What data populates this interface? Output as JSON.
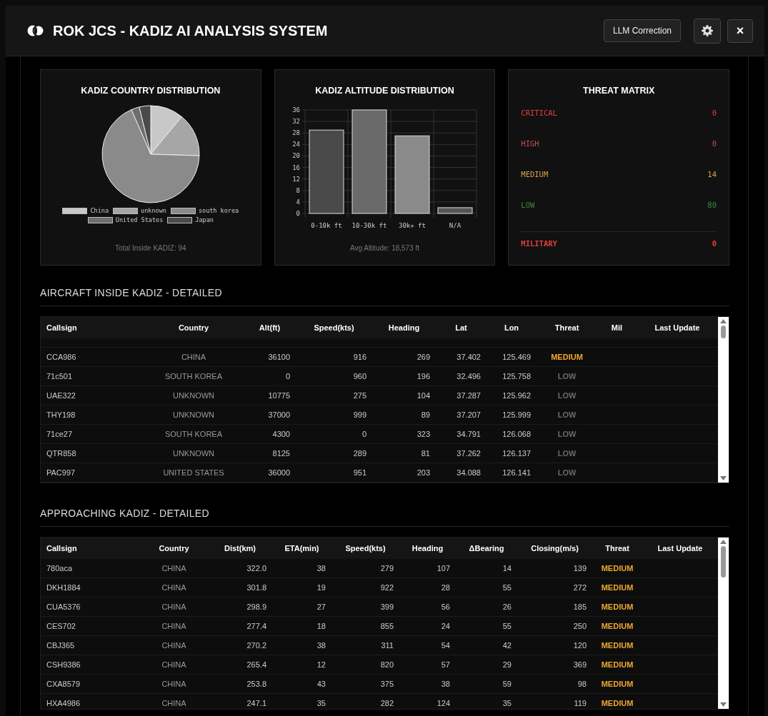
{
  "window": {
    "title": "ROK JCS - KADIZ AI ANALYSIS SYSTEM",
    "buttons": {
      "llm": "LLM Correction",
      "close": "×"
    }
  },
  "country_panel": {
    "title": "KADIZ COUNTRY DISTRIBUTION",
    "legend": [
      {
        "label": "China",
        "color": "#c8c8c8"
      },
      {
        "label": "unknown",
        "color": "#a6a6a6"
      },
      {
        "label": "south korea",
        "color": "#8a8a8a"
      },
      {
        "label": "United States",
        "color": "#6e6e6e"
      },
      {
        "label": "Japan",
        "color": "#4a4a4a"
      }
    ],
    "footer": "Total Inside KADIZ: 94"
  },
  "altitude_panel": {
    "title": "KADIZ ALTITUDE DISTRIBUTION",
    "chart_data": {
      "type": "bar",
      "categories": [
        "0-10k ft",
        "10-30k ft",
        "30k+ ft",
        "N/A"
      ],
      "values": [
        29,
        36,
        27,
        2
      ],
      "grid": true,
      "ylim": [
        0,
        36
      ],
      "yticks": [
        0,
        4,
        8,
        12,
        16,
        20,
        24,
        28,
        32,
        36
      ]
    },
    "footer": "Avg Altitude: 18,573 ft"
  },
  "threat_matrix": {
    "title": "THREAT MATRIX",
    "levels": [
      {
        "label": "CRITICAL",
        "value": "0",
        "color": "#e0403c"
      },
      {
        "label": "HIGH",
        "value": "0",
        "color": "#c0504c"
      },
      {
        "label": "MEDIUM",
        "value": "14",
        "color": "#d6a44a"
      },
      {
        "label": "LOW",
        "value": "80",
        "color": "#3f8a3f"
      }
    ],
    "military": {
      "label": "MILITARY",
      "value": "0"
    }
  },
  "inside_table": {
    "title": "AIRCRAFT INSIDE KADIZ - DETAILED",
    "columns": [
      "Callsign",
      "Country",
      "Alt(ft)",
      "Speed(kts)",
      "Heading",
      "Lat",
      "Lon",
      "Threat",
      "Mil",
      "Last Update"
    ],
    "rows": [
      {
        "cells": [
          "CCA986",
          "CHINA",
          "36100",
          "916",
          "269",
          "37.402",
          "125.469"
        ],
        "threat": {
          "text": "MEDIUM",
          "color": "#f0a830"
        }
      },
      {
        "cells": [
          "71c501",
          "SOUTH KOREA",
          "0",
          "960",
          "196",
          "32.496",
          "125.758"
        ],
        "threat": {
          "text": "LOW",
          "color": "#6a6a6a"
        }
      },
      {
        "cells": [
          "UAE322",
          "UNKNOWN",
          "10775",
          "275",
          "104",
          "37.287",
          "125.962"
        ],
        "threat": {
          "text": "LOW",
          "color": "#6a6a6a"
        }
      },
      {
        "cells": [
          "THY198",
          "UNKNOWN",
          "37000",
          "999",
          "89",
          "37.207",
          "125.999"
        ],
        "threat": {
          "text": "LOW",
          "color": "#6a6a6a"
        }
      },
      {
        "cells": [
          "71ce27",
          "SOUTH KOREA",
          "4300",
          "0",
          "323",
          "34.791",
          "126.068"
        ],
        "threat": {
          "text": "LOW",
          "color": "#6a6a6a"
        }
      },
      {
        "cells": [
          "QTR858",
          "UNKNOWN",
          "8125",
          "289",
          "81",
          "37.262",
          "126.137"
        ],
        "threat": {
          "text": "LOW",
          "color": "#6a6a6a"
        }
      },
      {
        "cells": [
          "PAC997",
          "UNITED STATES",
          "36000",
          "951",
          "203",
          "34.088",
          "126.141"
        ],
        "threat": {
          "text": "LOW",
          "color": "#6a6a6a"
        }
      }
    ]
  },
  "approaching_table": {
    "title": "APPROACHING KADIZ - DETAILED",
    "columns": [
      "Callsign",
      "Country",
      "Dist(km)",
      "ETA(min)",
      "Speed(kts)",
      "Heading",
      "ΔBearing",
      "Closing(m/s)",
      "Threat",
      "Last Update"
    ],
    "rows": [
      {
        "cells": [
          "780aca",
          "CHINA",
          "322.0",
          "38",
          "279",
          "107",
          "14",
          "139"
        ],
        "threat": {
          "text": "MEDIUM",
          "color": "#f0a830"
        }
      },
      {
        "cells": [
          "DKH1884",
          "CHINA",
          "301.8",
          "19",
          "922",
          "28",
          "55",
          "272"
        ],
        "threat": {
          "text": "MEDIUM",
          "color": "#f0a830"
        }
      },
      {
        "cells": [
          "CUA5376",
          "CHINA",
          "298.9",
          "27",
          "399",
          "56",
          "26",
          "185"
        ],
        "threat": {
          "text": "MEDIUM",
          "color": "#f0a830"
        }
      },
      {
        "cells": [
          "CES702",
          "CHINA",
          "277.4",
          "18",
          "855",
          "24",
          "55",
          "250"
        ],
        "threat": {
          "text": "MEDIUM",
          "color": "#f0a830"
        }
      },
      {
        "cells": [
          "CBJ365",
          "CHINA",
          "270.2",
          "38",
          "311",
          "54",
          "42",
          "120"
        ],
        "threat": {
          "text": "MEDIUM",
          "color": "#f0a830"
        }
      },
      {
        "cells": [
          "CSH9386",
          "CHINA",
          "265.4",
          "12",
          "820",
          "57",
          "29",
          "369"
        ],
        "threat": {
          "text": "MEDIUM",
          "color": "#f0a830"
        }
      },
      {
        "cells": [
          "CXA8579",
          "CHINA",
          "253.8",
          "43",
          "375",
          "38",
          "59",
          "98"
        ],
        "threat": {
          "text": "MEDIUM",
          "color": "#f0a830"
        }
      },
      {
        "cells": [
          "HXA4986",
          "CHINA",
          "247.1",
          "35",
          "282",
          "124",
          "35",
          "119"
        ],
        "threat": {
          "text": "MEDIUM",
          "color": "#f0a830"
        }
      }
    ]
  }
}
